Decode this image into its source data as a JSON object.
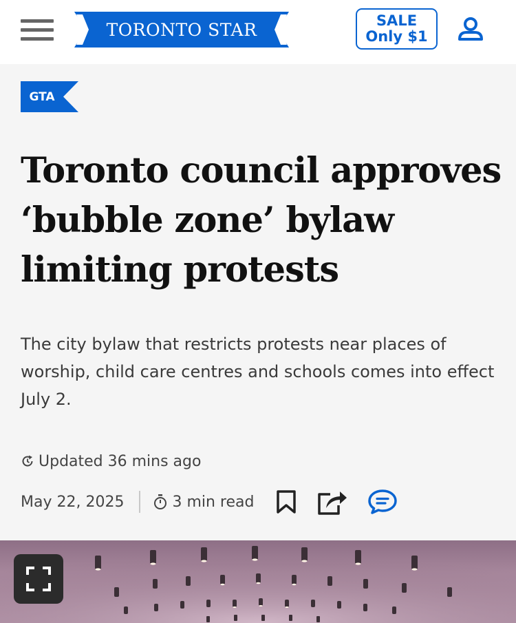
{
  "header": {
    "menu_icon": "hamburger-menu-icon",
    "logo_text": "TORONTO STAR",
    "sale_line1": "SALE",
    "sale_line2": "Only $1",
    "account_icon": "user-account-icon"
  },
  "article": {
    "section_tag": "GTA",
    "headline": "Toronto council approves ‘bubble zone’ bylaw limiting protests",
    "dek": "The city bylaw that restricts protests near places of worship, child care centres and schools comes into effect July 2.",
    "updated": "Updated 36 mins ago",
    "date": "May 22, 2025",
    "read_time": "3 min read",
    "action_icons": [
      "bookmark-icon",
      "share-icon",
      "comment-icon"
    ]
  },
  "hero": {
    "expand_icon": "fullscreen-expand-icon"
  },
  "colors": {
    "brand_blue": "#0a64d1",
    "background": "#f5f5f5",
    "header_bg": "#ffffff"
  }
}
